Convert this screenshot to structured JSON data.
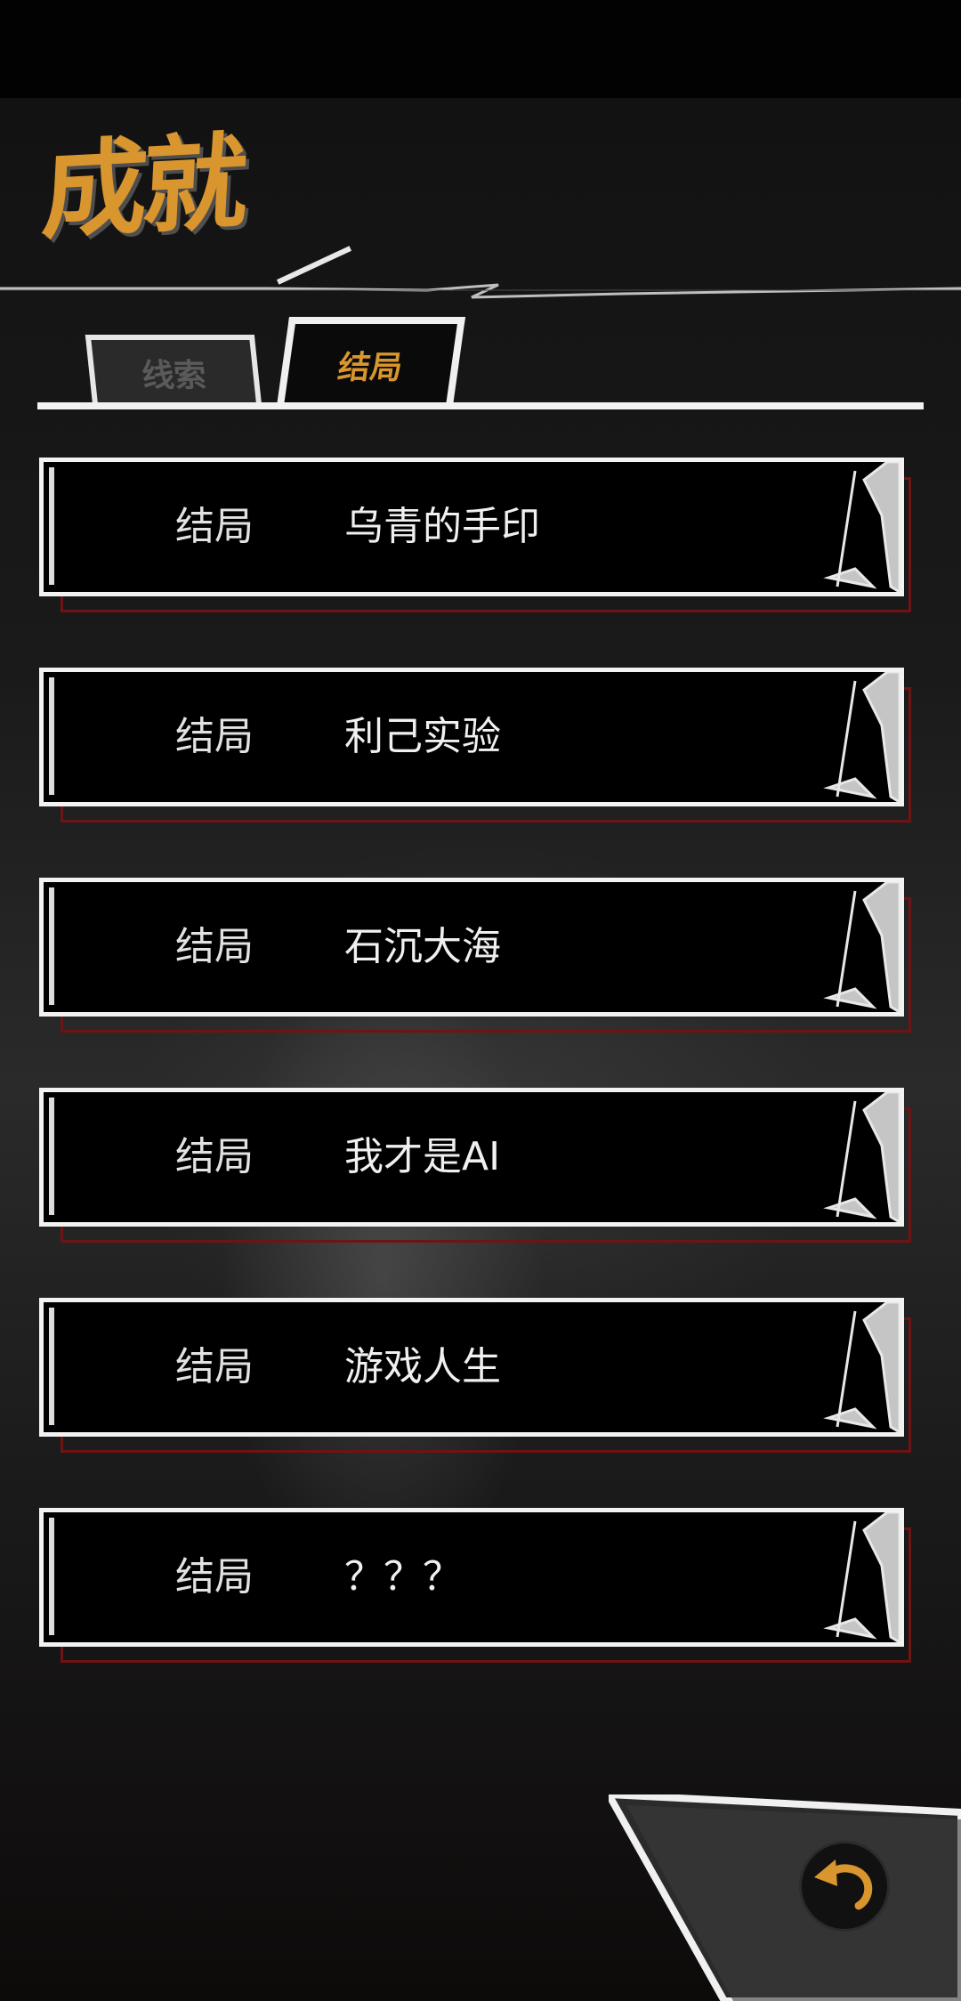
{
  "page": {
    "title": "成就"
  },
  "tabs": [
    {
      "label": "线索",
      "active": false
    },
    {
      "label": "结局",
      "active": true
    }
  ],
  "endings": [
    {
      "label": "结局",
      "name": "乌青的手印"
    },
    {
      "label": "结局",
      "name": "利己实验"
    },
    {
      "label": "结局",
      "name": "石沉大海"
    },
    {
      "label": "结局",
      "name": "我才是AI"
    },
    {
      "label": "结局",
      "name": "游戏人生"
    },
    {
      "label": "结局",
      "name": "？？？"
    }
  ],
  "colors": {
    "accent": "#d9952e",
    "card_border": "#f2f2f2",
    "shadow_frame": "#6e1414"
  },
  "icons": {
    "back": "back-arrow-icon"
  }
}
